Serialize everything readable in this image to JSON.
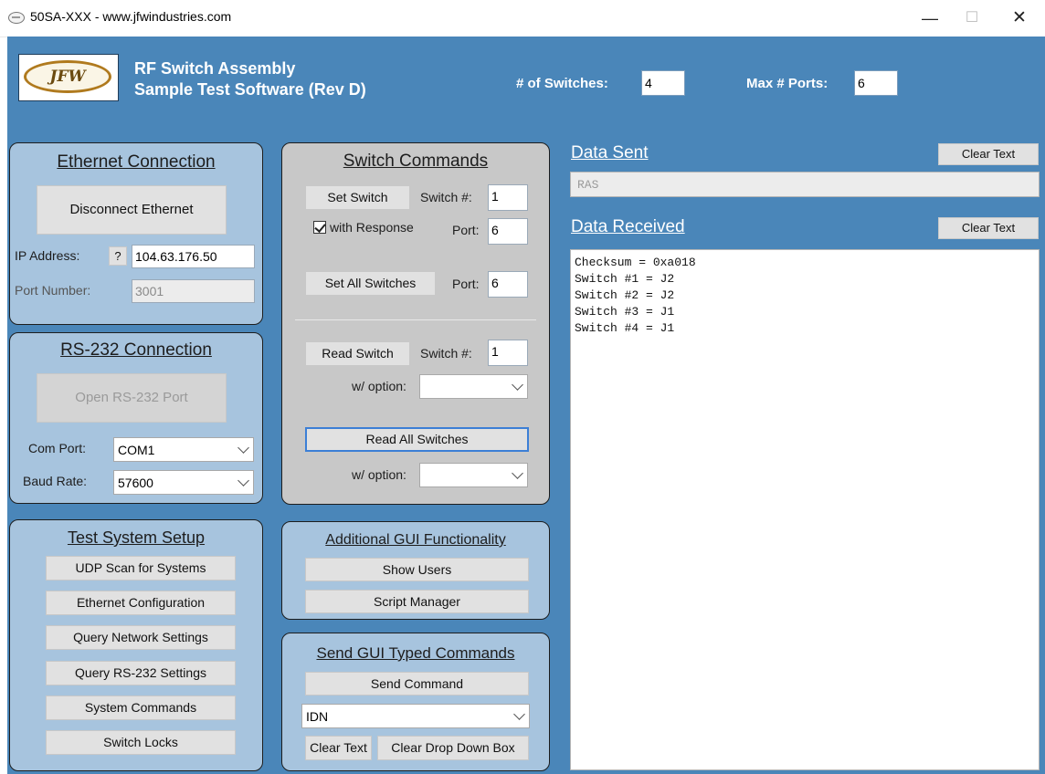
{
  "window": {
    "title": "50SA-XXX - www.jfwindustries.com",
    "minimize": "—",
    "maximize": "☐",
    "close": "✕"
  },
  "header": {
    "logo_text": "JFW",
    "title_line1": "RF Switch Assembly",
    "title_line2": "Sample Test Software (Rev D)",
    "num_switches_label": "# of Switches:",
    "num_switches_value": "4",
    "max_ports_label": "Max # Ports:",
    "max_ports_value": "6"
  },
  "ethernet": {
    "title": "Ethernet Connection",
    "connect_button": "Disconnect Ethernet",
    "ip_label": "IP Address:",
    "ip_help": "?",
    "ip_value": "104.63.176.50",
    "port_label": "Port Number:",
    "port_value": "3001"
  },
  "rs232": {
    "title": "RS-232 Connection",
    "open_button": "Open RS-232 Port",
    "com_label": "Com Port:",
    "com_value": "COM1",
    "baud_label": "Baud Rate:",
    "baud_value": "57600"
  },
  "setup": {
    "title": "Test System Setup",
    "buttons": [
      "UDP Scan for Systems",
      "Ethernet Configuration",
      "Query Network Settings",
      "Query RS-232 Settings",
      "System Commands",
      "Switch Locks"
    ]
  },
  "switch_commands": {
    "title": "Switch Commands",
    "set_switch": "Set Switch",
    "switch_num_label": "Switch #:",
    "switch_num_value": "1",
    "with_response": "with Response",
    "port_label": "Port:",
    "port_value": "6",
    "set_all": "Set All Switches",
    "set_all_port_label": "Port:",
    "set_all_port_value": "6",
    "read_switch": "Read Switch",
    "read_switch_num_label": "Switch #:",
    "read_switch_num_value": "1",
    "option_label": "w/ option:",
    "option_value": "",
    "read_all": "Read All Switches",
    "option2_label": "w/ option:",
    "option2_value": ""
  },
  "additional": {
    "title": "Additional GUI Functionality",
    "show_users": "Show Users",
    "script_manager": "Script Manager"
  },
  "typed": {
    "title": "Send GUI Typed Commands",
    "send_button": "Send Command",
    "command_value": "IDN",
    "clear_text": "Clear Text",
    "clear_dropdown": "Clear Drop Down Box"
  },
  "data_sent": {
    "title": "Data Sent",
    "clear_button": "Clear Text",
    "value": "RAS"
  },
  "data_received": {
    "title": "Data Received",
    "clear_button": "Clear Text",
    "lines": [
      "Checksum = 0xa018",
      "Switch #1 = J2",
      "Switch #2 = J2",
      "Switch #3 = J1",
      "Switch #4 = J1"
    ]
  }
}
